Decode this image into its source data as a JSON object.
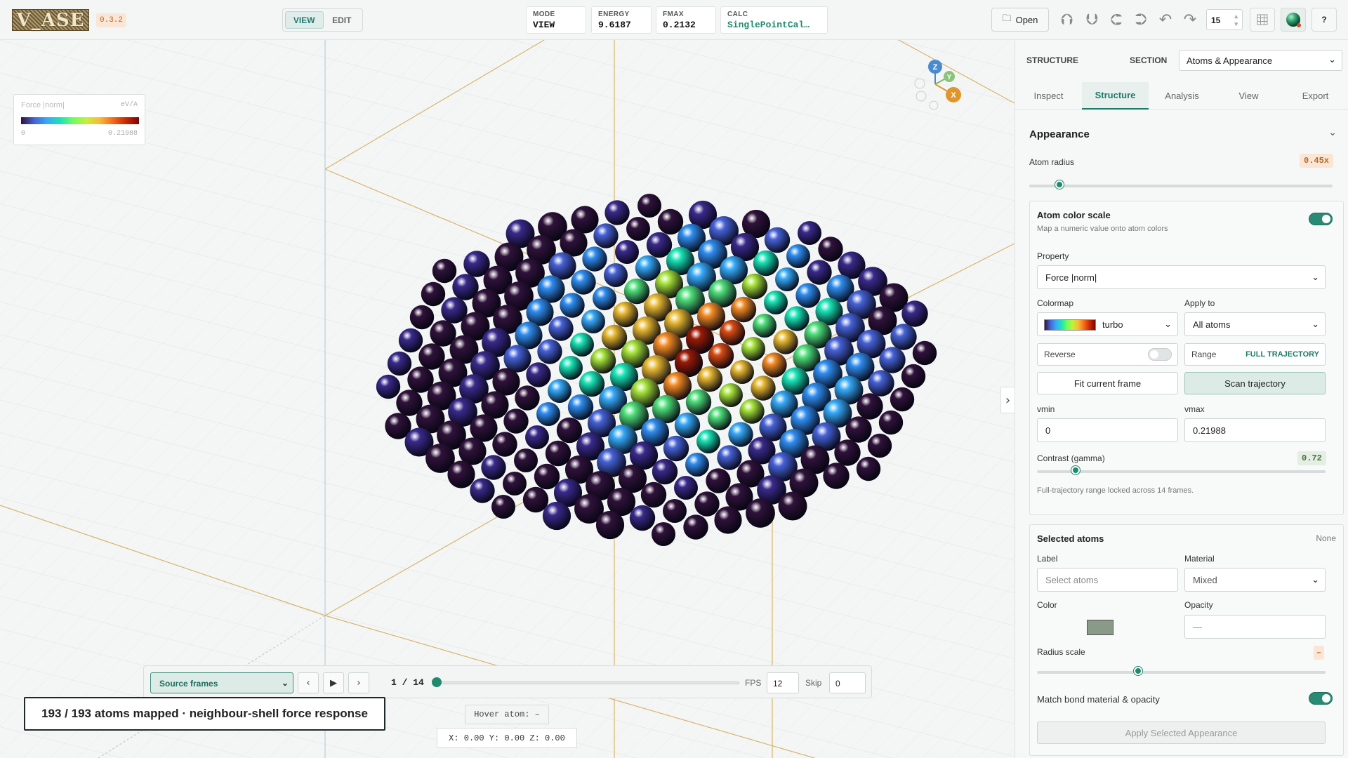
{
  "app": {
    "logo_text": "V_ASE",
    "version": "0.3.2",
    "mode_view": "VIEW",
    "mode_edit": "EDIT",
    "stats": [
      {
        "key": "MODE",
        "value": "VIEW"
      },
      {
        "key": "ENERGY",
        "value": "9.6187"
      },
      {
        "key": "FMAX",
        "value": "0.2132"
      },
      {
        "key": "CALC",
        "value": "SinglePointCal…"
      }
    ],
    "open_label": "Open",
    "step_value": "15",
    "help_label": "?"
  },
  "legend": {
    "title": "Force |norm|",
    "unit": "eV/A",
    "min": "0",
    "max": "0.21988"
  },
  "axes": {
    "x": "X",
    "y": "Y",
    "z": "Z"
  },
  "playback": {
    "source": "Source frames",
    "frame": "1 / 14",
    "progress_fraction": 0,
    "fps_label": "FPS",
    "fps": "12",
    "skip_label": "Skip",
    "skip": "0"
  },
  "caption": "193 / 193 atoms mapped · neighbour-shell force response",
  "hover": "Hover atom: –",
  "coords": "X: 0.00 Y: 0.00 Z: 0.00",
  "panel": {
    "title": "STRUCTURE",
    "section_label": "SECTION",
    "section_value": "Atoms & Appearance",
    "tabs": [
      "Inspect",
      "Structure",
      "Analysis",
      "View",
      "Export"
    ],
    "appearance_title": "Appearance",
    "atom_radius_label": "Atom radius",
    "atom_radius_value": "0.45x",
    "colorscale": {
      "title": "Atom color scale",
      "subtitle": "Map a numeric value onto atom colors",
      "property_label": "Property",
      "property_value": "Force |norm|",
      "colormap_label": "Colormap",
      "colormap_value": "turbo",
      "apply_label": "Apply to",
      "apply_value": "All atoms",
      "reverse_label": "Reverse",
      "range_label": "Range",
      "range_value": "FULL TRAJECTORY",
      "fit_label": "Fit current frame",
      "scan_label": "Scan trajectory",
      "vmin_label": "vmin",
      "vmin_value": "0",
      "vmax_label": "vmax",
      "vmax_value": "0.21988",
      "gamma_label": "Contrast (gamma)",
      "gamma_value": "0.72",
      "note": "Full-trajectory range locked across 14 frames."
    },
    "selected": {
      "title": "Selected atoms",
      "status": "None",
      "label_label": "Label",
      "label_placeholder": "Select atoms",
      "material_label": "Material",
      "material_value": "Mixed",
      "color_label": "Color",
      "opacity_label": "Opacity",
      "opacity_placeholder": "—",
      "radius_label": "Radius scale",
      "radius_value": "–",
      "match_label": "Match bond material & opacity",
      "apply_label": "Apply Selected Appearance"
    }
  }
}
